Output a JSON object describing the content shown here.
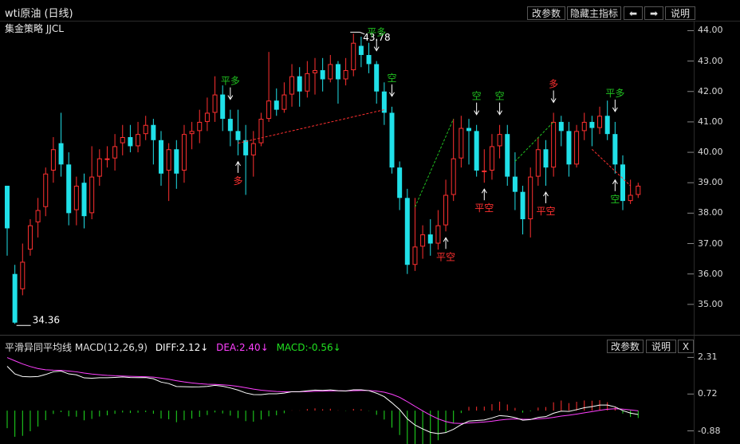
{
  "window": {
    "title": "wti原油 (日线)",
    "strategy": "集金策略 JJCL",
    "buttons": {
      "params": "改参数",
      "hide_main": "隐藏主指标",
      "prev": "⬅",
      "next": "➡",
      "help": "说明"
    }
  },
  "main_chart": {
    "y_ticks": [
      "44.00",
      "43.00",
      "42.00",
      "41.00",
      "40.00",
      "39.00",
      "38.00",
      "37.00",
      "36.00",
      "35.00"
    ],
    "y_range": [
      34.0,
      44.3
    ],
    "high_label": "43.78",
    "low_label": "34.36",
    "colors": {
      "up": "#ff3030",
      "down": "#20e0e8",
      "bull_signal": "#ff3030",
      "bear_signal": "#20c020"
    },
    "signals": [
      {
        "text": "平多",
        "color": "bear",
        "idx": 29,
        "above": true
      },
      {
        "text": "多",
        "color": "bull",
        "idx": 30,
        "above": false
      },
      {
        "text": "平多",
        "color": "bear",
        "idx": 48,
        "above": true
      },
      {
        "text": "空",
        "color": "bear",
        "idx": 50,
        "above": true
      },
      {
        "text": "平空",
        "color": "bull",
        "idx": 57,
        "above": false
      },
      {
        "text": "空",
        "color": "bear",
        "idx": 61,
        "above": true
      },
      {
        "text": "平空",
        "color": "bull",
        "idx": 62,
        "above": false
      },
      {
        "text": "空",
        "color": "bear",
        "idx": 64,
        "above": true
      },
      {
        "text": "多",
        "color": "bull",
        "idx": 71,
        "above": true
      },
      {
        "text": "平空",
        "color": "bull",
        "idx": 70,
        "above": false
      },
      {
        "text": "平多",
        "color": "bear",
        "idx": 79,
        "above": true
      },
      {
        "text": "空",
        "color": "bear",
        "idx": 79,
        "above": false
      }
    ]
  },
  "candles": [
    [
      38.9,
      37.5,
      38.9,
      36.6
    ],
    [
      36.0,
      34.4,
      36.3,
      34.36
    ],
    [
      35.5,
      36.4,
      37.0,
      35.3
    ],
    [
      36.8,
      37.6,
      37.8,
      36.6
    ],
    [
      37.7,
      38.1,
      38.5,
      37.2
    ],
    [
      38.2,
      39.3,
      39.5,
      37.9
    ],
    [
      39.4,
      40.1,
      40.5,
      39.0
    ],
    [
      40.3,
      39.6,
      41.3,
      39.2
    ],
    [
      39.6,
      38.0,
      40.0,
      37.6
    ],
    [
      38.1,
      38.9,
      39.2,
      37.6
    ],
    [
      39.0,
      37.9,
      39.3,
      37.5
    ],
    [
      38.0,
      39.2,
      40.2,
      37.8
    ],
    [
      39.2,
      39.8,
      40.1,
      38.9
    ],
    [
      39.8,
      39.8,
      40.2,
      39.5
    ],
    [
      39.8,
      40.2,
      40.6,
      39.4
    ],
    [
      40.3,
      40.5,
      40.9,
      39.9
    ],
    [
      40.5,
      40.2,
      40.9,
      40.0
    ],
    [
      40.2,
      40.6,
      41.0,
      40.0
    ],
    [
      40.6,
      40.9,
      41.2,
      40.4
    ],
    [
      40.9,
      40.4,
      41.1,
      39.6
    ],
    [
      40.4,
      39.3,
      40.7,
      38.9
    ],
    [
      39.4,
      40.1,
      40.3,
      38.4
    ],
    [
      40.1,
      39.3,
      40.4,
      38.8
    ],
    [
      39.4,
      40.6,
      40.9,
      39.0
    ],
    [
      40.6,
      40.7,
      41.0,
      40.1
    ],
    [
      40.7,
      41.0,
      41.4,
      40.3
    ],
    [
      41.0,
      41.3,
      41.8,
      40.7
    ],
    [
      41.3,
      41.9,
      42.5,
      41.0
    ],
    [
      41.9,
      41.1,
      42.2,
      40.7
    ],
    [
      41.1,
      40.7,
      41.4,
      40.2
    ],
    [
      40.7,
      40.4,
      41.4,
      39.9
    ],
    [
      40.4,
      39.9,
      40.9,
      38.6
    ],
    [
      39.9,
      40.3,
      40.7,
      39.2
    ],
    [
      40.3,
      41.1,
      41.3,
      40.2
    ],
    [
      41.1,
      41.7,
      43.3,
      41.0
    ],
    [
      41.7,
      41.4,
      42.1,
      41.2
    ],
    [
      41.4,
      41.9,
      42.3,
      41.3
    ],
    [
      41.9,
      42.5,
      42.9,
      41.5
    ],
    [
      42.5,
      42.0,
      42.8,
      41.5
    ],
    [
      42.0,
      42.6,
      43.0,
      41.8
    ],
    [
      42.6,
      42.7,
      43.1,
      41.9
    ],
    [
      42.7,
      42.4,
      43.1,
      42.0
    ],
    [
      42.4,
      42.9,
      43.2,
      42.3
    ],
    [
      42.9,
      42.4,
      43.0,
      41.6
    ],
    [
      42.4,
      42.7,
      43.1,
      42.2
    ],
    [
      42.7,
      43.6,
      43.9,
      42.5
    ],
    [
      43.5,
      43.2,
      43.8,
      42.8
    ],
    [
      43.2,
      42.9,
      43.6,
      42.6
    ],
    [
      42.9,
      42.0,
      43.0,
      41.6
    ],
    [
      42.0,
      41.3,
      42.3,
      40.9
    ],
    [
      41.3,
      39.5,
      41.5,
      39.3
    ],
    [
      39.5,
      38.5,
      39.7,
      38.1
    ],
    [
      38.5,
      36.3,
      38.8,
      36.0
    ],
    [
      36.3,
      36.9,
      38.5,
      36.1
    ],
    [
      36.9,
      37.3,
      37.6,
      36.5
    ],
    [
      37.3,
      37.0,
      37.8,
      36.6
    ],
    [
      37.0,
      37.6,
      38.1,
      36.8
    ],
    [
      37.6,
      38.6,
      39.1,
      37.4
    ],
    [
      38.6,
      39.8,
      41.1,
      38.4
    ],
    [
      39.8,
      40.8,
      41.2,
      39.5
    ],
    [
      40.8,
      40.7,
      41.1,
      39.6
    ],
    [
      40.7,
      39.4,
      40.9,
      39.2
    ],
    [
      39.4,
      39.4,
      40.1,
      39.0
    ],
    [
      39.4,
      40.2,
      40.6,
      39.1
    ],
    [
      40.2,
      40.6,
      40.9,
      39.8
    ],
    [
      40.6,
      39.2,
      40.9,
      38.9
    ],
    [
      39.2,
      38.7,
      40.0,
      38.1
    ],
    [
      38.7,
      37.8,
      38.9,
      37.3
    ],
    [
      37.8,
      39.2,
      39.5,
      37.2
    ],
    [
      39.2,
      40.1,
      40.5,
      38.9
    ],
    [
      40.1,
      39.5,
      40.4,
      38.9
    ],
    [
      39.5,
      41.0,
      41.3,
      39.2
    ],
    [
      41.0,
      40.7,
      41.2,
      40.2
    ],
    [
      40.7,
      39.6,
      41.0,
      39.2
    ],
    [
      39.6,
      40.7,
      40.9,
      39.5
    ],
    [
      40.7,
      41.0,
      41.3,
      40.4
    ],
    [
      41.0,
      40.8,
      41.2,
      40.2
    ],
    [
      40.8,
      41.2,
      41.5,
      40.6
    ],
    [
      41.2,
      40.6,
      41.7,
      40.4
    ],
    [
      40.6,
      39.6,
      41.0,
      39.3
    ],
    [
      39.6,
      38.4,
      39.9,
      38.1
    ],
    [
      38.4,
      38.6,
      39.1,
      38.3
    ],
    [
      38.6,
      38.9,
      39.0,
      38.5
    ]
  ],
  "macd": {
    "title": "平滑异同平均线",
    "params": "MACD(12,26,9)",
    "diff": "DIFF:2.12↓",
    "dea": "DEA:2.40↓",
    "macd": "MACD:-0.56↓",
    "y_ticks": [
      "2.31",
      "0.72",
      "-0.88"
    ],
    "colors": {
      "diff": "#ffffff",
      "dea": "#ff40ff",
      "macd_pos": "#ff3030",
      "macd_neg": "#20e020"
    },
    "buttons": {
      "params": "改参数",
      "help": "说明",
      "close": "X"
    }
  }
}
